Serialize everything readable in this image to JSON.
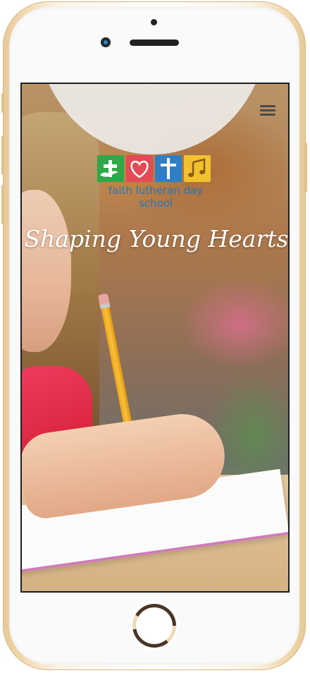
{
  "logo": {
    "text": "faith lutheran day school",
    "tiles": [
      {
        "name": "cross-bird-tile",
        "color": "#2ea84a"
      },
      {
        "name": "heart-tile",
        "color": "#e34a55"
      },
      {
        "name": "bible-tile",
        "color": "#2f7fc7"
      },
      {
        "name": "music-note-tile",
        "color": "#f2c12e"
      }
    ]
  },
  "hero": {
    "tagline": "Shaping Young Hearts"
  },
  "header": {
    "menu_icon": "hamburger-menu-icon"
  },
  "colors": {
    "logo_text": "#2a74b8",
    "phone_gold": "#e7c996"
  }
}
